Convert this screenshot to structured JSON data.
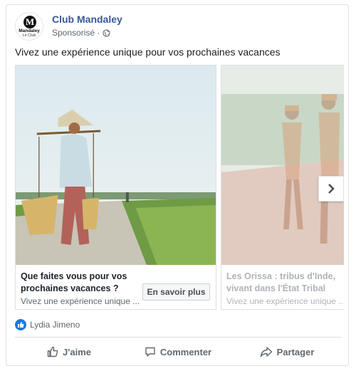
{
  "post": {
    "page_name": "Club Mandaley",
    "logo_brand": "Mandaley",
    "logo_sub": "Le Club",
    "logo_letter": "M",
    "sponsored_label": "Sponsorisé ·",
    "text": "Vivez une expérience unique pour vos prochaines vacances"
  },
  "carousel": {
    "slides": [
      {
        "title": "Que faites vous pour vos prochaines vacances ?",
        "description": "Vivez une expérience unique ...",
        "cta": "En savoir plus"
      },
      {
        "title": "Les Orissa : tribus d'Inde, vivant dans l'État Tribal",
        "description": "Vivez une expérience unique ..."
      }
    ]
  },
  "social": {
    "liker_name": "Lydia Jimeno"
  },
  "actions": {
    "like": "J'aime",
    "comment": "Commenter",
    "share": "Partager"
  },
  "colors": {
    "page_link": "#385898",
    "like_badge": "#1877f2",
    "muted_text": "#606770"
  }
}
